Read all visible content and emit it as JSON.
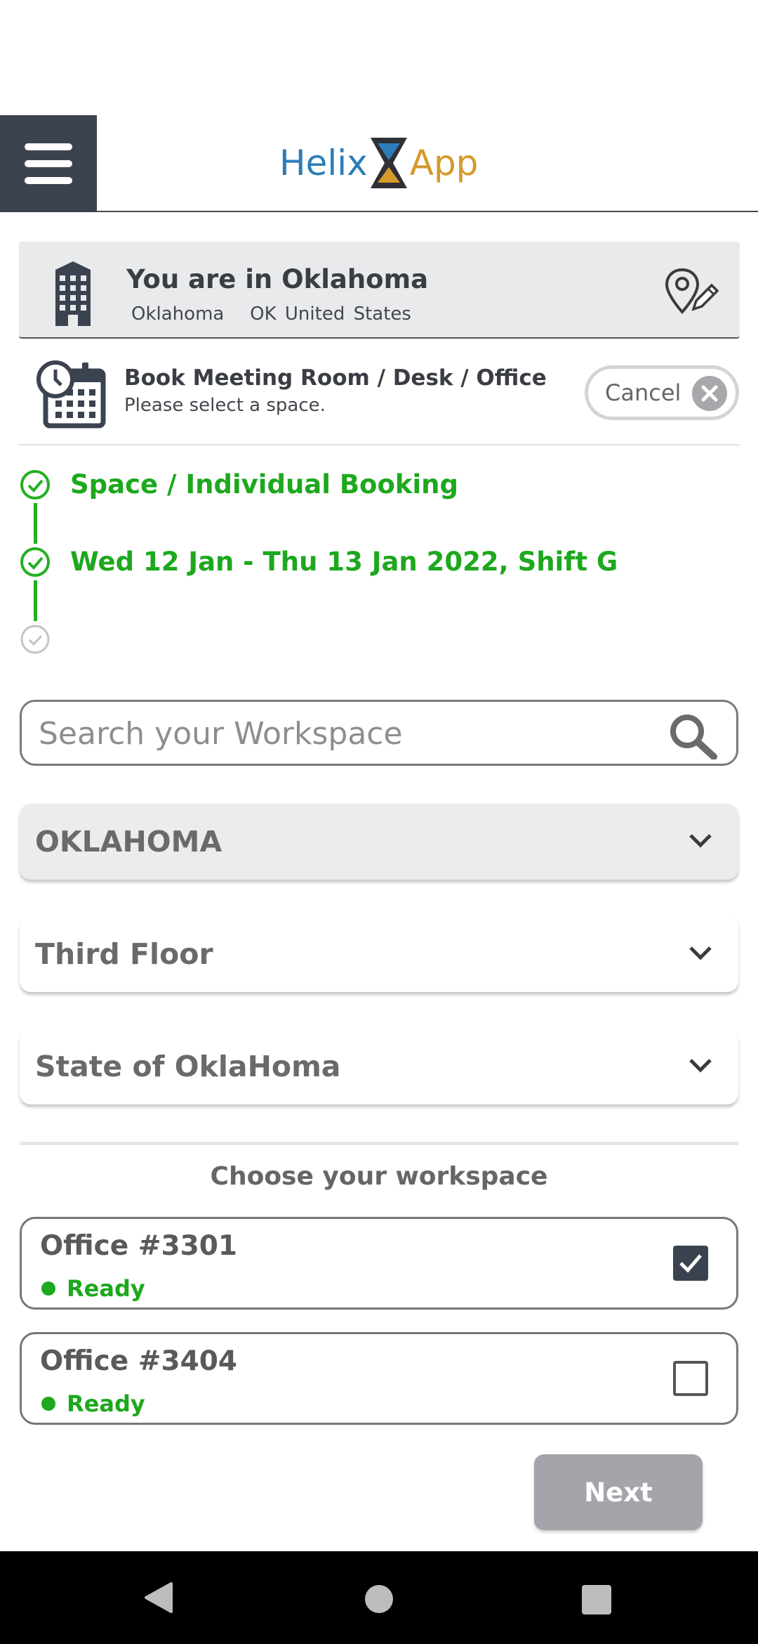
{
  "app": {
    "logo_left": "Helix",
    "logo_right": "App"
  },
  "location": {
    "title": "You are in Oklahoma",
    "city": "Oklahoma",
    "state": "OK",
    "country": "United States"
  },
  "booking": {
    "title": "Book Meeting Room / Desk / Office",
    "subtitle": "Please select a space.",
    "cancel_label": "Cancel"
  },
  "steps": [
    {
      "label": "Space / Individual Booking",
      "done": true
    },
    {
      "label": "Wed 12 Jan - Thu 13 Jan 2022, Shift G",
      "done": true
    },
    {
      "label": "",
      "done": false
    }
  ],
  "search": {
    "placeholder": "Search your Workspace",
    "value": ""
  },
  "filters": [
    {
      "label": "OKLAHOMA"
    },
    {
      "label": "Third Floor"
    },
    {
      "label": "State of OklaHoma"
    }
  ],
  "workspaces": {
    "title": "Choose your workspace",
    "items": [
      {
        "name": "Office #3301",
        "status": "Ready",
        "selected": true
      },
      {
        "name": "Office #3404",
        "status": "Ready",
        "selected": false
      }
    ]
  },
  "actions": {
    "next_label": "Next"
  },
  "colors": {
    "primary_dark": "#3b4350",
    "success_green": "#1da81d",
    "logo_blue": "#2b7db8",
    "logo_gold": "#d49a2a",
    "disabled_button": "#a3a5aa"
  }
}
